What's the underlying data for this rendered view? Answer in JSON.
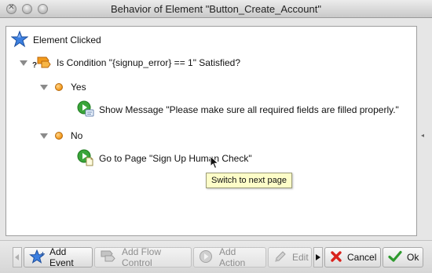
{
  "window": {
    "title": "Behavior of Element \"Button_Create_Account\""
  },
  "tree": {
    "event": "Element Clicked",
    "condition": "Is Condition \"{signup_error} == 1\" Satisfied?",
    "condition_badge": "?",
    "branches": [
      {
        "label": "Yes",
        "action": "Show Message \"Please make sure all required fields are filled properly.\""
      },
      {
        "label": "No",
        "action": "Go to Page \"Sign Up Human Check\""
      }
    ]
  },
  "tooltip": "Switch to next page",
  "toolbar": {
    "add_event": "Add Event",
    "add_flow_control": "Add Flow Control",
    "add_action": "Add Action",
    "edit": "Edit",
    "cancel": "Cancel",
    "ok": "Ok"
  },
  "colors": {
    "accent_blue": "#2d6fd6",
    "action_green": "#3aa53a",
    "cancel_red": "#d9221c",
    "ok_green": "#2f9a2f"
  },
  "icons": [
    "close-icon",
    "star-icon",
    "condition-icon",
    "show-message-icon",
    "goto-page-icon",
    "add-flow-control-icon",
    "add-action-icon",
    "pencil-icon",
    "cancel-x-icon",
    "ok-check-icon"
  ]
}
